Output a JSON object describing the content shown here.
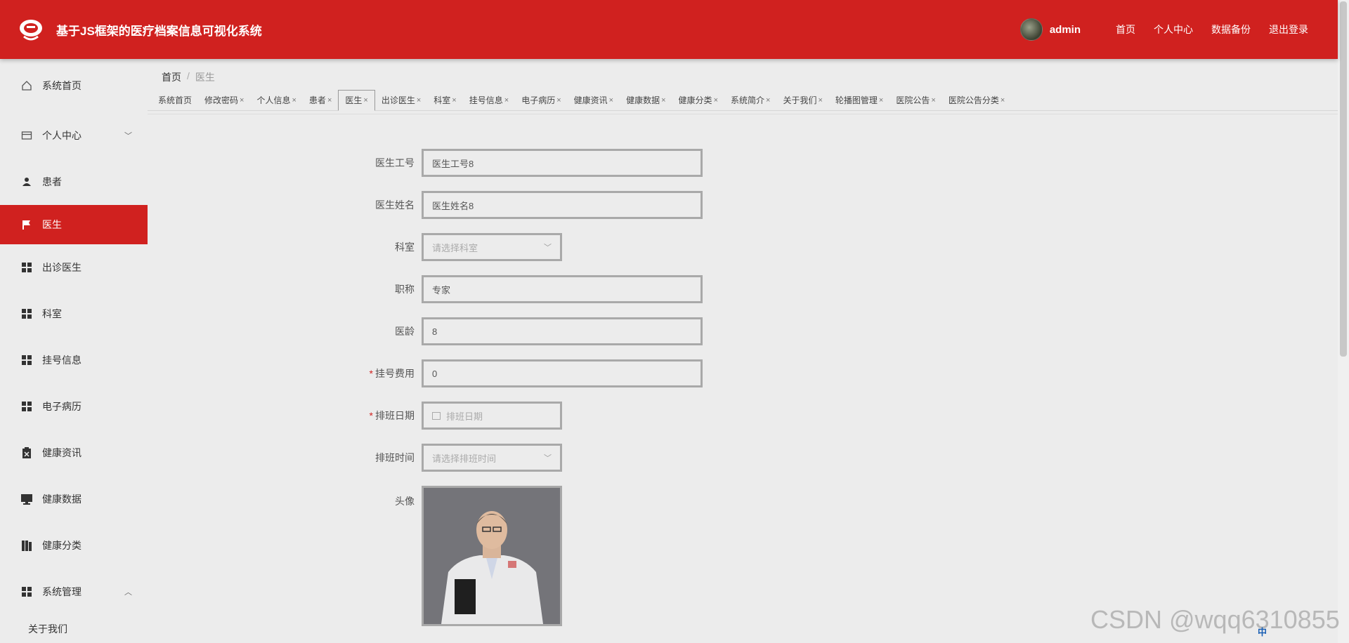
{
  "header": {
    "title": "基于JS框架的医疗档案信息可视化系统",
    "username": "admin",
    "links": [
      "首页",
      "个人中心",
      "数据备份",
      "退出登录"
    ]
  },
  "sidebar": {
    "items": [
      {
        "label": "系统首页",
        "icon": "home-icon"
      },
      {
        "label": "个人中心",
        "icon": "card-icon"
      },
      {
        "label": "患者",
        "icon": "user-icon"
      },
      {
        "label": "医生",
        "icon": "flag-icon"
      },
      {
        "label": "出诊医生",
        "icon": "grid-icon"
      },
      {
        "label": "科室",
        "icon": "grid-icon"
      },
      {
        "label": "挂号信息",
        "icon": "grid-icon"
      },
      {
        "label": "电子病历",
        "icon": "grid-icon"
      },
      {
        "label": "健康资讯",
        "icon": "clipboard-icon"
      },
      {
        "label": "健康数据",
        "icon": "monitor-icon"
      },
      {
        "label": "健康分类",
        "icon": "book-icon"
      },
      {
        "label": "系统管理",
        "icon": "grid-icon"
      }
    ],
    "sub_items": [
      "关于我们"
    ]
  },
  "breadcrumb": {
    "home": "首页",
    "sep": "/",
    "current": "医生"
  },
  "tabs": [
    {
      "label": "系统首页",
      "closable": false
    },
    {
      "label": "修改密码",
      "closable": true
    },
    {
      "label": "个人信息",
      "closable": true
    },
    {
      "label": "患者",
      "closable": true
    },
    {
      "label": "医生",
      "closable": true,
      "active": true
    },
    {
      "label": "出诊医生",
      "closable": true
    },
    {
      "label": "科室",
      "closable": true
    },
    {
      "label": "挂号信息",
      "closable": true
    },
    {
      "label": "电子病历",
      "closable": true
    },
    {
      "label": "健康资讯",
      "closable": true
    },
    {
      "label": "健康数据",
      "closable": true
    },
    {
      "label": "健康分类",
      "closable": true
    },
    {
      "label": "系统简介",
      "closable": true
    },
    {
      "label": "关于我们",
      "closable": true
    },
    {
      "label": "轮播图管理",
      "closable": true
    },
    {
      "label": "医院公告",
      "closable": true
    },
    {
      "label": "医院公告分类",
      "closable": true
    }
  ],
  "tab_close_glyph": "×",
  "form": {
    "doctor_id": {
      "label": "医生工号",
      "value": "医生工号8"
    },
    "doctor_name": {
      "label": "医生姓名",
      "value": "医生姓名8"
    },
    "department": {
      "label": "科室",
      "placeholder": "请选择科室"
    },
    "title": {
      "label": "职称",
      "value": "专家"
    },
    "experience": {
      "label": "医龄",
      "value": "8"
    },
    "fee": {
      "label": "挂号费用",
      "value": "0",
      "required_mark": "*"
    },
    "schedule_date": {
      "label": "排班日期",
      "placeholder": "排班日期",
      "required_mark": "*"
    },
    "schedule_time": {
      "label": "排班时间",
      "placeholder": "请选择排班时间"
    },
    "avatar": {
      "label": "头像"
    }
  },
  "watermark": "CSDN @wqq6310855",
  "tray": {
    "ime": "中"
  },
  "colors": {
    "primary": "#d0211f",
    "background": "#ececec"
  }
}
